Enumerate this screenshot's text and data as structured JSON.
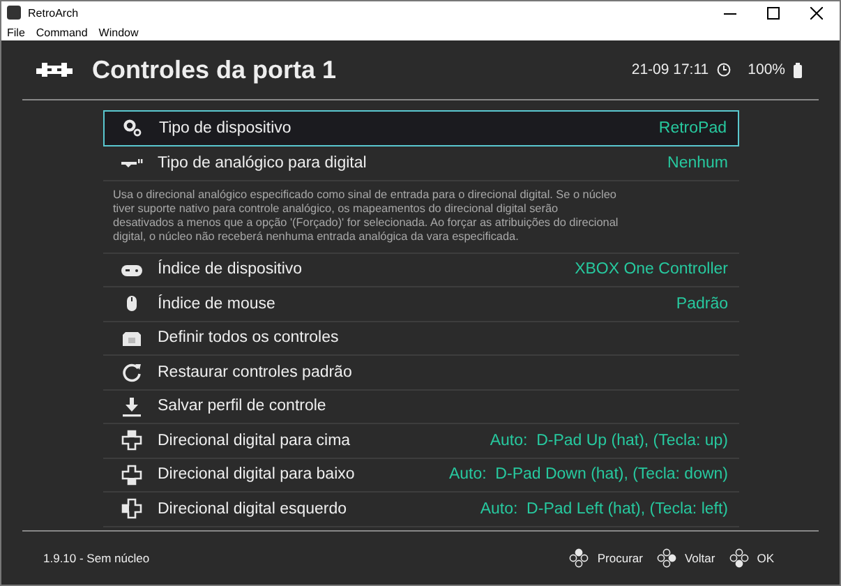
{
  "window": {
    "title": "RetroArch"
  },
  "menu_bar": [
    "File",
    "Command",
    "Window"
  ],
  "header": {
    "title": "Controles da porta 1",
    "clock": "21-09 17:11",
    "battery": "100%"
  },
  "items": [
    {
      "kind": "setting",
      "label": "Tipo de dispositivo",
      "value": "RetroPad",
      "selected": true
    },
    {
      "kind": "setting",
      "label": "Tipo de analógico para digital",
      "value": "Nenhum",
      "selected": false
    },
    {
      "kind": "description",
      "text": "Usa o direcional analógico especificado como sinal de entrada para o direcional digital. Se o núcleo tiver suporte nativo para controle analógico, os mapeamentos do direcional digital serão desativados a menos que a opção '(Forçado)' for selecionada. Ao forçar as atribuições do direcional digital, o núcleo não receberá nenhuma entrada analógica da vara especificada."
    },
    {
      "kind": "setting",
      "label": "Índice de dispositivo",
      "value": "XBOX One Controller",
      "selected": false
    },
    {
      "kind": "setting",
      "label": "Índice de mouse",
      "value": "Padrão",
      "selected": false
    },
    {
      "kind": "setting",
      "label": "Definir todos os controles",
      "selected": false
    },
    {
      "kind": "setting",
      "label": "Restaurar controles padrão",
      "selected": false
    },
    {
      "kind": "setting",
      "label": "Salvar perfil de controle",
      "selected": false
    },
    {
      "kind": "setting",
      "label": "Direcional digital para cima",
      "value": "Auto:  D-Pad Up (hat), (Tecla: up)",
      "selected": false
    },
    {
      "kind": "setting",
      "label": "Direcional digital para baixo",
      "value": "Auto:  D-Pad Down (hat), (Tecla: down)",
      "selected": false
    },
    {
      "kind": "setting",
      "label": "Direcional digital esquerdo",
      "value": "Auto:  D-Pad Left (hat), (Tecla: left)",
      "selected": false
    }
  ],
  "footer": {
    "version": "1.9.10 - Sem núcleo",
    "actions": [
      "Procurar",
      "Voltar",
      "OK"
    ]
  }
}
